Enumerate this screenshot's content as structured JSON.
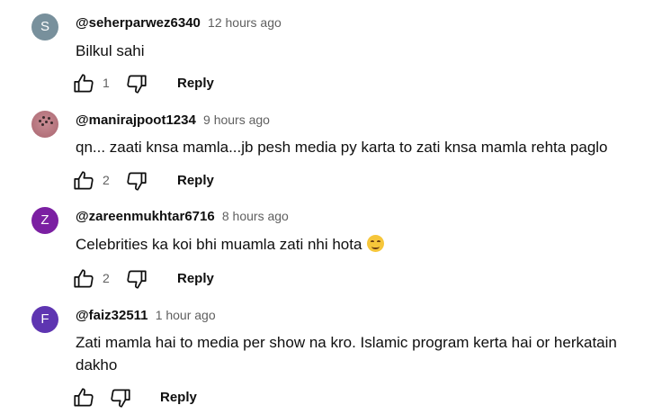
{
  "comments": [
    {
      "avatar_letter": "S",
      "avatar_color": "#78909c",
      "handle": "@seherparwez6340",
      "time": "12 hours ago",
      "text": "Bilkul sahi",
      "likes": "1",
      "reply_label": "Reply"
    },
    {
      "avatar_letter": "",
      "avatar_color": "#b77780",
      "handle": "@manirajpoot1234",
      "time": "9 hours ago",
      "text": "qn... zaati knsa mamla...jb pesh media py karta to zati knsa mamla rehta paglo",
      "likes": "2",
      "reply_label": "Reply"
    },
    {
      "avatar_letter": "Z",
      "avatar_color": "#7b1fa2",
      "handle": "@zareenmukhtar6716",
      "time": "8 hours ago",
      "text": "Celebrities ka koi bhi muamla zati nhi hota",
      "emoji": "smiling-face-emoji",
      "likes": "2",
      "reply_label": "Reply"
    },
    {
      "avatar_letter": "F",
      "avatar_color": "#5e35b1",
      "handle": "@faiz32511",
      "time": "1 hour ago",
      "text": "Zati mamla hai to media per show na kro. Islamic program kerta hai or herkatain dakho",
      "likes": "",
      "reply_label": "Reply"
    }
  ],
  "icons": {
    "like": "thumbs-up-icon",
    "dislike": "thumbs-down-icon"
  }
}
